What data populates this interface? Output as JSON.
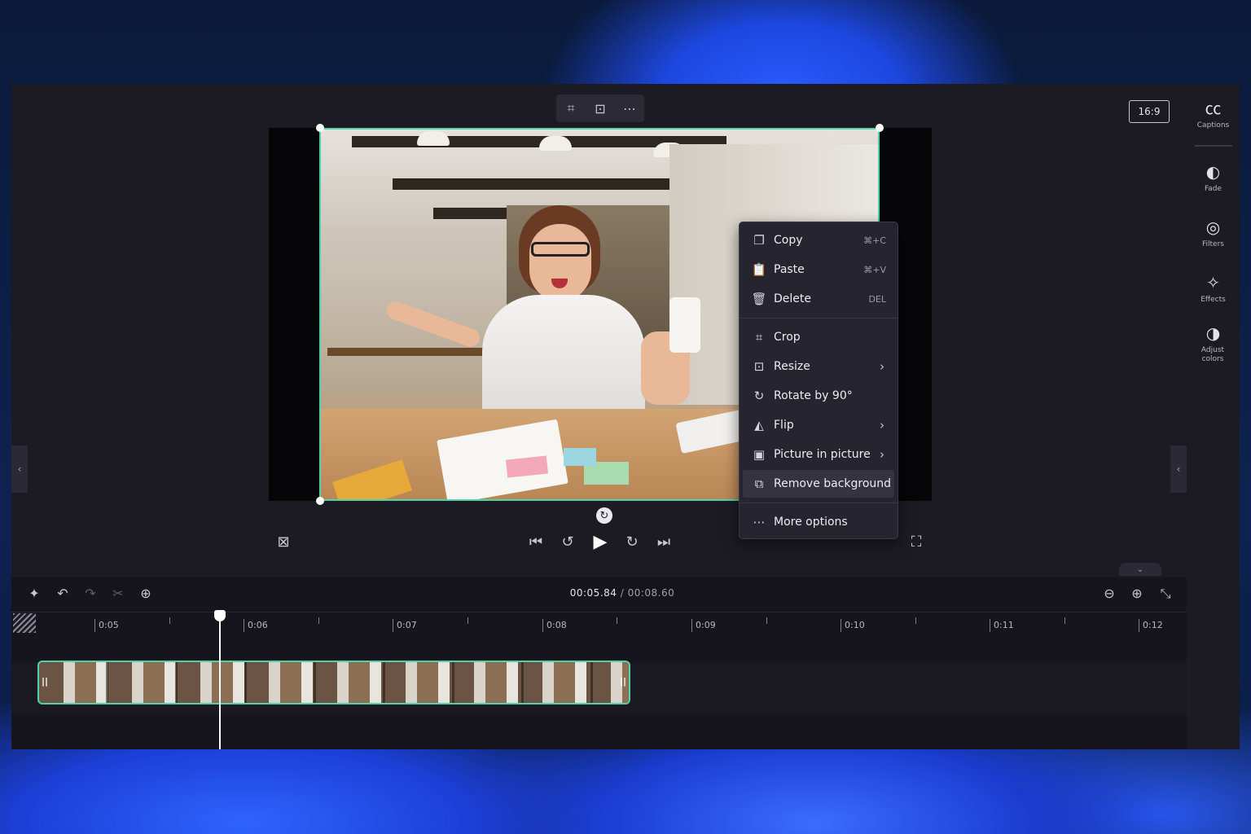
{
  "toolbar_mini": {
    "crop_icon": "⌗",
    "resize_icon": "⊡",
    "more_icon": "⋯"
  },
  "aspect_ratio": "16:9",
  "context_menu": {
    "items": [
      {
        "icon": "copy-icon",
        "glyph": "❐",
        "label": "Copy",
        "shortcut": "⌘+C"
      },
      {
        "icon": "paste-icon",
        "glyph": "📋",
        "label": "Paste",
        "shortcut": "⌘+V"
      },
      {
        "icon": "delete-icon",
        "glyph": "🗑",
        "label": "Delete",
        "shortcut": "DEL"
      },
      {
        "icon": "crop-icon",
        "glyph": "⌗",
        "label": "Crop"
      },
      {
        "icon": "resize-icon",
        "glyph": "⊡",
        "label": "Resize",
        "submenu": true
      },
      {
        "icon": "rotate-icon",
        "glyph": "↻",
        "label": "Rotate by 90°"
      },
      {
        "icon": "flip-icon",
        "glyph": "◭",
        "label": "Flip",
        "submenu": true
      },
      {
        "icon": "picture-in-picture-icon",
        "glyph": "▣",
        "label": "Picture in picture",
        "submenu": true
      },
      {
        "icon": "remove-background-icon",
        "glyph": "⧉",
        "label": "Remove background",
        "highlighted": true
      },
      {
        "icon": "more-options-icon",
        "glyph": "⋯",
        "label": "More options"
      }
    ],
    "chevron": "›"
  },
  "right_rail": [
    {
      "icon": "captions-icon",
      "glyph": "㏄",
      "label": "Captions"
    },
    {
      "icon": "fade-icon",
      "glyph": "◐",
      "label": "Fade"
    },
    {
      "icon": "filters-icon",
      "glyph": "◎",
      "label": "Filters"
    },
    {
      "icon": "effects-icon",
      "glyph": "✧",
      "label": "Effects"
    },
    {
      "icon": "adjust-colors-icon",
      "glyph": "◑",
      "label": "Adjust colors"
    }
  ],
  "playback": {
    "captions_off": "⊠",
    "skip_start": "⏮",
    "rewind": "↺",
    "play": "▶",
    "forward": "↻",
    "skip_end": "⏭",
    "fullscreen": "⛶",
    "rotate": "↻"
  },
  "timeline": {
    "current_time": "00:05.84",
    "total_time": "/ 00:08.60",
    "ticks": [
      "0:05",
      "0:06",
      "0:07",
      "0:08",
      "0:09",
      "0:10",
      "0:11",
      "0:12"
    ],
    "tools": {
      "magic": "✦",
      "undo": "↶",
      "redo": "↷",
      "split": "✂",
      "add_clip": "⊕"
    },
    "zoom": {
      "zoom_out": "⊖",
      "zoom_in": "⊕",
      "fit": "⤡"
    }
  },
  "colors": {
    "accent": "#4fd1a9",
    "panel": "#1c1b24",
    "menu": "#26252f"
  }
}
